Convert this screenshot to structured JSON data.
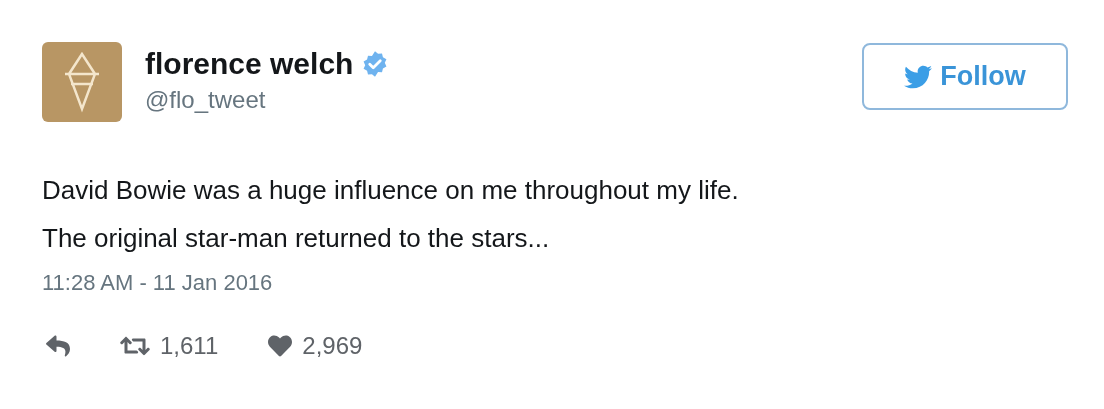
{
  "tweet": {
    "author": {
      "name": "florence welch",
      "handle": "@flo_tweet",
      "verified": true
    },
    "follow_button": {
      "label": "Follow"
    },
    "text_lines": [
      "David Bowie was a huge influence on me throughout my life.",
      "The original star-man returned to the stars..."
    ],
    "timestamp": "11:28 AM - 11 Jan 2016",
    "actions": [
      {
        "kind": "reply"
      },
      {
        "kind": "retweet",
        "count": "1,611"
      },
      {
        "kind": "like",
        "count": "2,969"
      }
    ]
  }
}
